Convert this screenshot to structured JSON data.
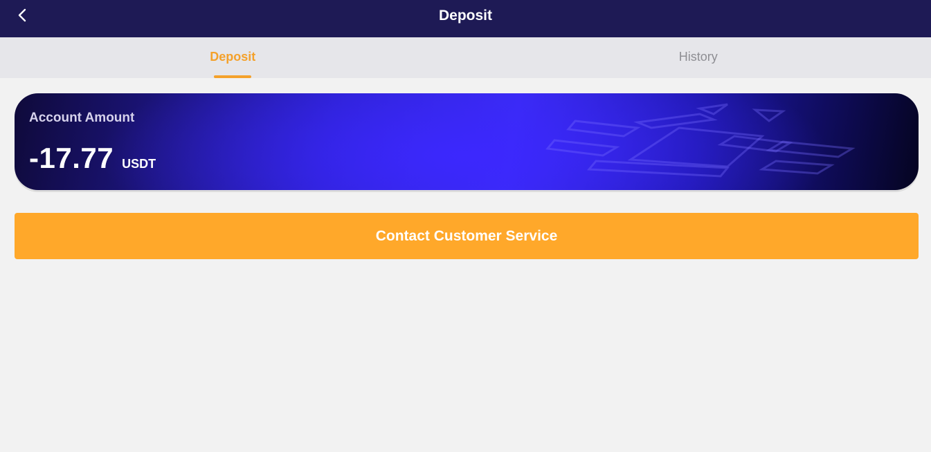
{
  "header": {
    "title": "Deposit",
    "back_icon": "chevron-left-icon"
  },
  "tabs": [
    {
      "label": "Deposit",
      "active": true
    },
    {
      "label": "History",
      "active": false
    }
  ],
  "account_card": {
    "label": "Account Amount",
    "amount": "-17.77",
    "currency": "USDT"
  },
  "actions": {
    "contact_label": "Contact Customer Service"
  },
  "colors": {
    "header_bg": "#1e1a55",
    "accent": "#f4a12b",
    "button_bg": "#ffa82a",
    "tab_bar_bg": "#e6e6ea",
    "page_bg": "#f2f2f2"
  }
}
